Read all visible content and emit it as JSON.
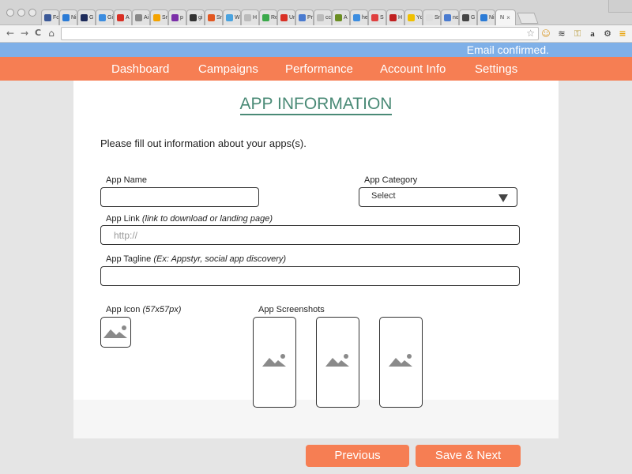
{
  "browser": {
    "tabs": [
      {
        "label": "Fc",
        "color": "#3b5998"
      },
      {
        "label": "Ni",
        "color": "#2b7bd6"
      },
      {
        "label": "G",
        "color": "#1d2b5a"
      },
      {
        "label": "Gi",
        "color": "#3c8de0"
      },
      {
        "label": "A",
        "color": "#d93025"
      },
      {
        "label": "Ai",
        "color": "#888888"
      },
      {
        "label": "Sr",
        "color": "#f4a300"
      },
      {
        "label": "p",
        "color": "#7b2fa8"
      },
      {
        "label": "gi",
        "color": "#333333"
      },
      {
        "label": "Sr",
        "color": "#e25822"
      },
      {
        "label": "W",
        "color": "#4aa3df"
      },
      {
        "label": "H",
        "color": "#bbbbbb"
      },
      {
        "label": "Re",
        "color": "#3aa94a"
      },
      {
        "label": "Ur",
        "color": "#d93025"
      },
      {
        "label": "Pr",
        "color": "#4a7bd0"
      },
      {
        "label": "cc",
        "color": "#bbbbbb"
      },
      {
        "label": "A",
        "color": "#6b8e23"
      },
      {
        "label": "he",
        "color": "#3c8de0"
      },
      {
        "label": "S",
        "color": "#e04040"
      },
      {
        "label": "H",
        "color": "#c02020"
      },
      {
        "label": "Yc",
        "color": "#f0c000"
      },
      {
        "label": "Sr",
        "color": "#dddddd"
      },
      {
        "label": "no",
        "color": "#4a7bd0"
      },
      {
        "label": "G",
        "color": "#444444"
      },
      {
        "label": "Ni",
        "color": "#2b7bd6"
      }
    ],
    "active_tab": {
      "label": "N",
      "close": "×"
    },
    "url": "",
    "nav": {
      "back": "←",
      "forward": "→",
      "reload": "C",
      "home": "⌂"
    },
    "star": "☆"
  },
  "notice": {
    "text": "Email confirmed."
  },
  "nav": {
    "items": [
      "Dashboard",
      "Campaigns",
      "Performance",
      "Account Info",
      "Settings"
    ]
  },
  "page": {
    "title": "APP INFORMATION",
    "intro": "Please fill out information about your apps(s)."
  },
  "form": {
    "app_name": {
      "label": "App Name",
      "value": "",
      "placeholder": ""
    },
    "app_category": {
      "label": "App Category",
      "selected": "Select"
    },
    "app_link": {
      "label": "App Link",
      "hint": "(link to download or landing page)",
      "value": "",
      "placeholder": "http://"
    },
    "app_tagline": {
      "label": "App Tagline",
      "hint": "(Ex: Appstyr, social app discovery)",
      "value": "",
      "placeholder": ""
    },
    "app_icon": {
      "label": "App Icon",
      "hint": "(57x57px)"
    },
    "app_screenshots": {
      "label": "App Screenshots",
      "count": 3
    }
  },
  "buttons": {
    "previous": "Previous",
    "save_next": "Save & Next"
  },
  "colors": {
    "accent": "#f67e53",
    "notice": "#7fb0e8",
    "title": "#4a8a76"
  }
}
